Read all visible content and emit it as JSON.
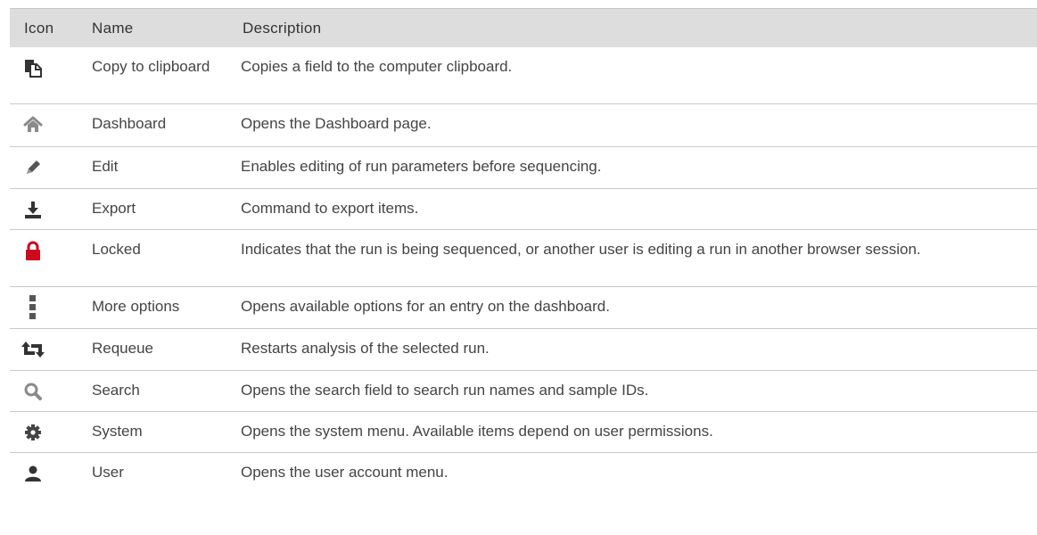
{
  "table": {
    "headers": {
      "icon": "Icon",
      "name": "Name",
      "description": "Description"
    },
    "rows": [
      {
        "icon": "copy-to-clipboard-icon",
        "name": "Copy to clipboard",
        "description": "Copies a field to the computer clipboard."
      },
      {
        "icon": "home-icon",
        "name": "Dashboard",
        "description": "Opens the Dashboard page."
      },
      {
        "icon": "pencil-icon",
        "name": "Edit",
        "description": "Enables editing of run parameters before sequencing."
      },
      {
        "icon": "export-download-icon",
        "name": "Export",
        "description": "Command to export items."
      },
      {
        "icon": "lock-icon",
        "name": "Locked",
        "description": "Indicates that the run is being sequenced, or another user is editing a run in another browser session."
      },
      {
        "icon": "vertical-dots-icon",
        "name": "More options",
        "description": "Opens available options for an entry on the dashboard."
      },
      {
        "icon": "requeue-icon",
        "name": "Requeue",
        "description": "Restarts analysis of the selected run."
      },
      {
        "icon": "search-icon",
        "name": "Search",
        "description": "Opens the search field to search run names and sample IDs."
      },
      {
        "icon": "gear-icon",
        "name": "System",
        "description": "Opens the system menu. Available items depend on user permissions."
      },
      {
        "icon": "user-icon",
        "name": "User",
        "description": "Opens the user account menu."
      }
    ]
  },
  "colors": {
    "header_bg": "#dddddd",
    "lock_red": "#cc0a1e",
    "icon_dark": "#333333",
    "icon_gray": "#8a8a8a"
  }
}
